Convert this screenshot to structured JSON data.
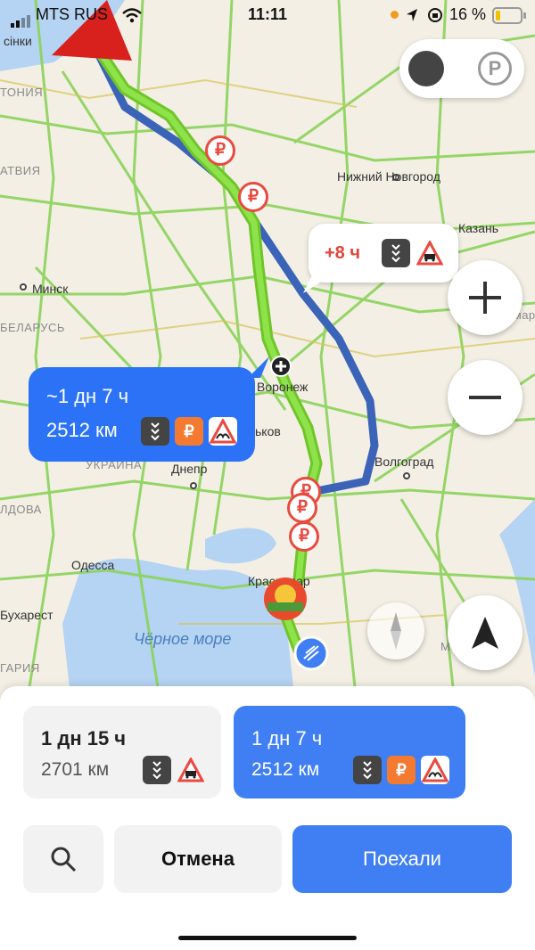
{
  "status_bar": {
    "carrier": "MTS RUS",
    "time": "11:11",
    "battery_percent": "16 %"
  },
  "map": {
    "cities": [
      {
        "name": "сінки",
        "style": "normal"
      },
      {
        "name": "ТОНИЯ",
        "style": "faint"
      },
      {
        "name": "АТВИЯ",
        "style": "faint"
      },
      {
        "name": "Нижний Новгород",
        "style": "normal"
      },
      {
        "name": "Казань",
        "style": "normal"
      },
      {
        "name": "Минск",
        "style": "normal"
      },
      {
        "name": "БЕЛАРУСЬ",
        "style": "faint"
      },
      {
        "name": "Воронеж",
        "style": "normal"
      },
      {
        "name": "ьков",
        "style": "normal"
      },
      {
        "name": "УКРАИНА",
        "style": "faint"
      },
      {
        "name": "Днепр",
        "style": "normal"
      },
      {
        "name": "Волгоград",
        "style": "normal"
      },
      {
        "name": "ЛДОВА",
        "style": "faint"
      },
      {
        "name": "Одесса",
        "style": "normal"
      },
      {
        "name": "Бухарест",
        "style": "normal"
      },
      {
        "name": "ГАРИЯ",
        "style": "faint"
      },
      {
        "name": "Краснодар",
        "style": "normal"
      },
      {
        "name": "Махачкала",
        "style": "faint"
      },
      {
        "name": "Самара",
        "style": "faint"
      }
    ],
    "sea_label": "Чёрное море",
    "route_callout_main": {
      "duration": "~1 дн 7 ч",
      "distance": "2512 км"
    },
    "route_callout_alt": {
      "delta": "+8 ч"
    },
    "toll_pin_symbol": "₽"
  },
  "controls": {
    "zoom_in_icon": "plus-icon",
    "zoom_out_icon": "minus-icon",
    "compass_icon": "compass-icon",
    "locate_icon": "navigation-arrow-icon",
    "layer_traffic_icon": "traffic-layer-icon",
    "layer_parking_label": "P"
  },
  "routes": [
    {
      "duration": "1 дн 15 ч",
      "distance": "2701 км",
      "badges": [
        "toll-road-icon",
        "railway-crossing-icon"
      ]
    },
    {
      "duration": "1 дн 7 ч",
      "distance": "2512 км",
      "badges": [
        "toll-road-icon",
        "paid-road-icon",
        "bumpy-road-icon"
      ],
      "paid_symbol": "₽"
    }
  ],
  "actions": {
    "cancel_label": "Отмена",
    "go_label": "Поехали"
  },
  "colors": {
    "accent": "#3f7ff3",
    "route_green": "#7dd634",
    "route_blue": "#3b63b8",
    "warning": "#e94a40",
    "paid": "#f47a32"
  }
}
